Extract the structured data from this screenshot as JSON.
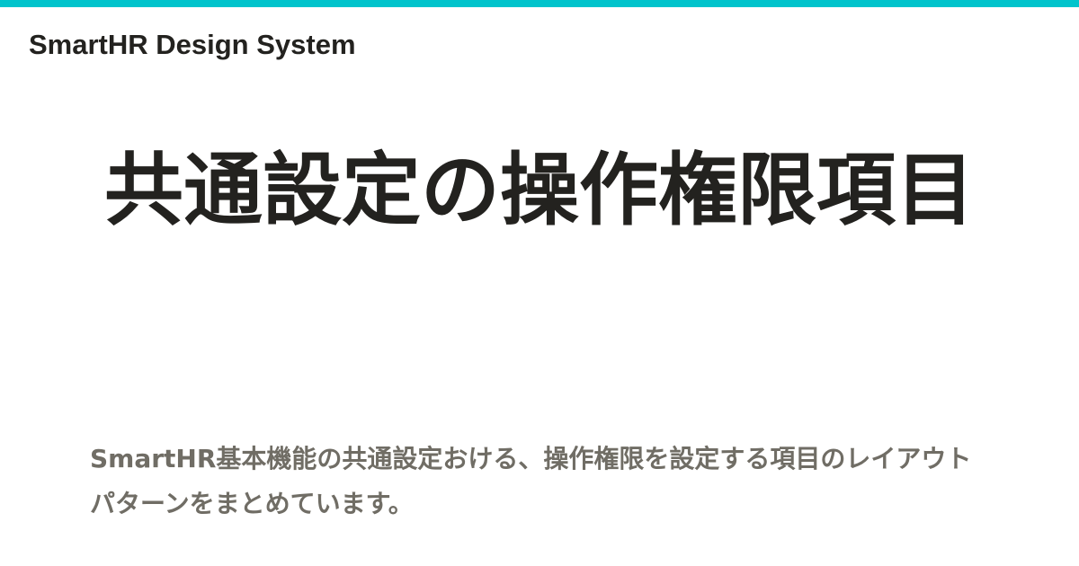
{
  "colors": {
    "accent": "#00c4cc",
    "text_main": "#23221f",
    "text_sub": "#706d65",
    "background": "#ffffff"
  },
  "header": {
    "brand": "SmartHR Design System"
  },
  "main": {
    "title": "共通設定の操作権限項目",
    "description": "SmartHR基本機能の共通設定おける、操作権限を設定する項目のレイアウトパターンをまとめています。"
  }
}
